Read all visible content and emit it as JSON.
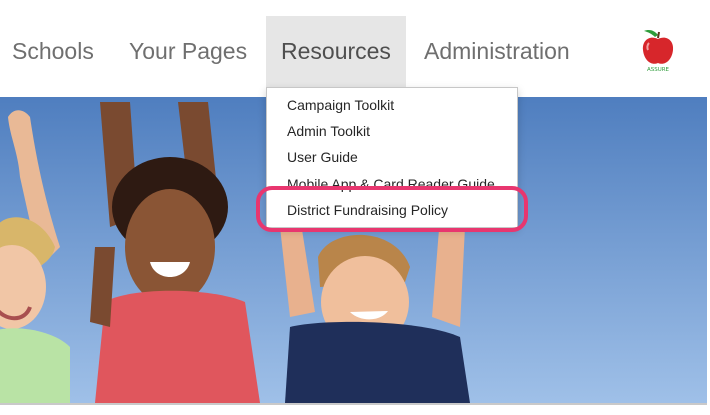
{
  "nav": {
    "items": [
      {
        "label": "Schools"
      },
      {
        "label": "Your Pages"
      },
      {
        "label": "Resources"
      },
      {
        "label": "Administration"
      }
    ],
    "active_index": 2
  },
  "logo": {
    "icon": "apple-logo-icon",
    "text": "ASSURE"
  },
  "menu": {
    "items": [
      {
        "label": "Campaign Toolkit"
      },
      {
        "label": "Admin Toolkit"
      },
      {
        "label": "User Guide"
      },
      {
        "label": "Mobile App & Card Reader Guide"
      },
      {
        "label": "District Fundraising Policy"
      }
    ],
    "highlighted_index": 4
  },
  "colors": {
    "highlight": "#e8366f",
    "sky": "#5b86c6",
    "nav_text": "#6f6f6f",
    "active_tab_bg": "#e6e6e6"
  }
}
